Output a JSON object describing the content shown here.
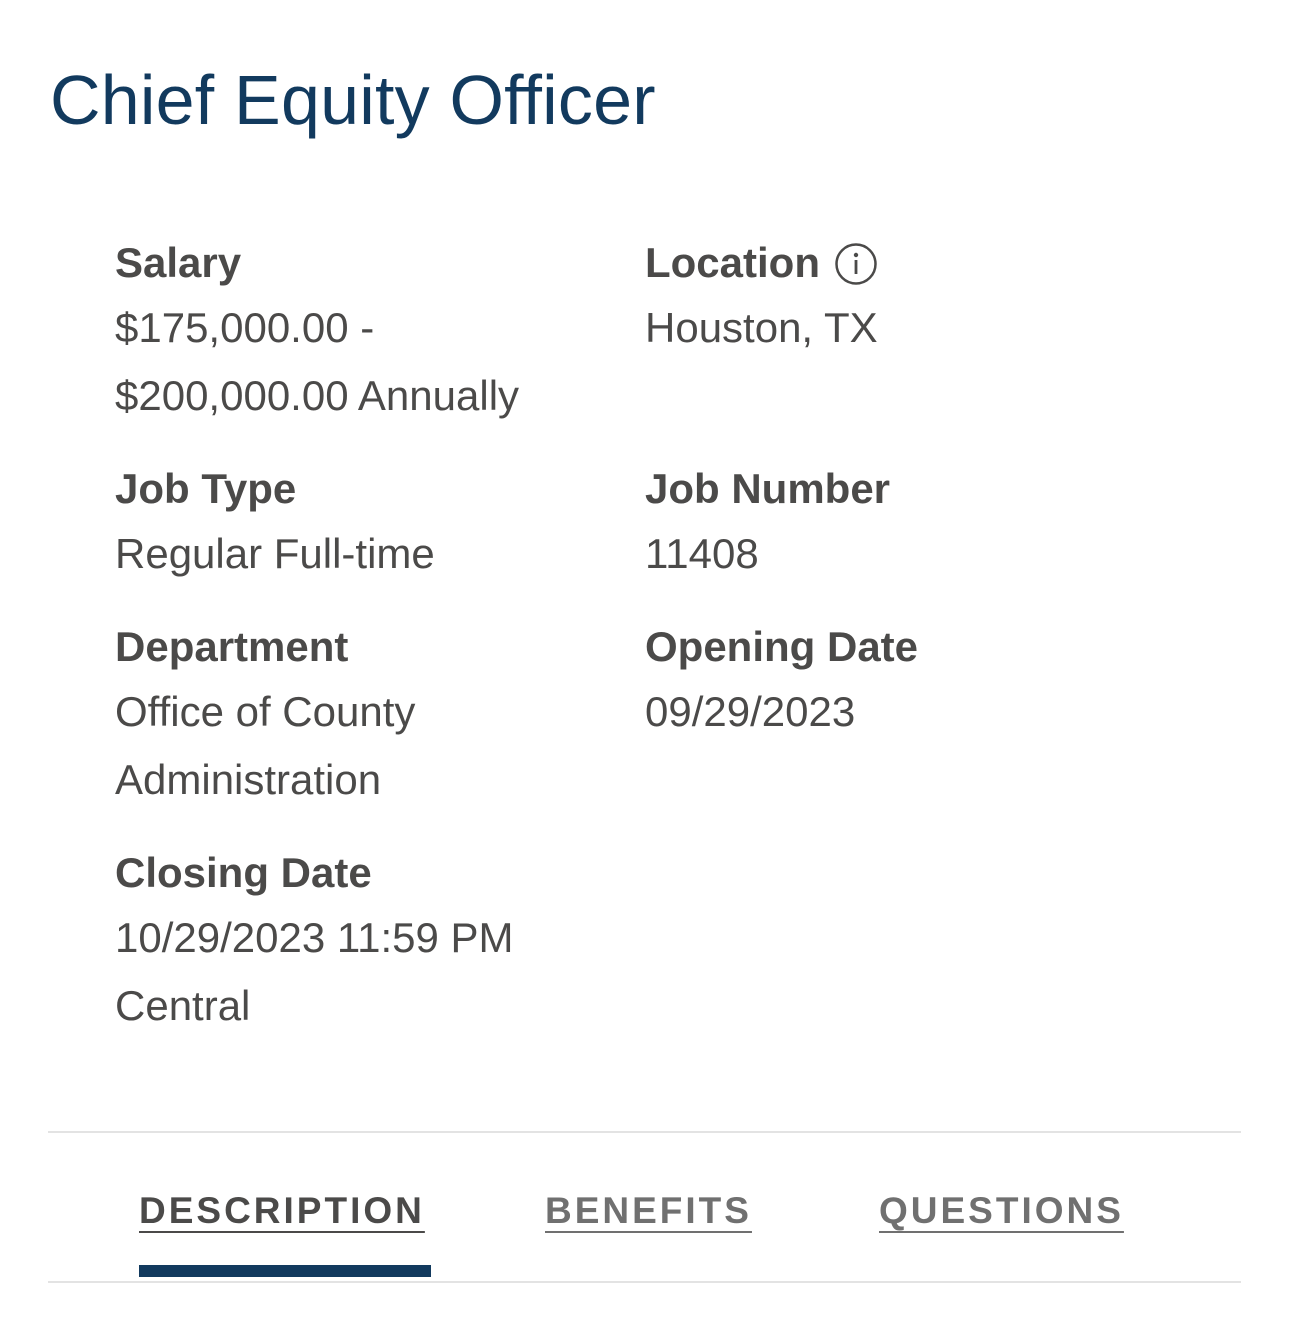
{
  "job": {
    "title": "Chief Equity Officer"
  },
  "details": {
    "salary": {
      "label": "Salary",
      "value_line1": "$175,000.00 -",
      "value_line2": "$200,000.00 Annually"
    },
    "location": {
      "label": "Location",
      "value": "Houston, TX",
      "icon": "info-icon"
    },
    "job_type": {
      "label": "Job Type",
      "value": "Regular Full-time"
    },
    "job_number": {
      "label": "Job Number",
      "value": "11408"
    },
    "department": {
      "label": "Department",
      "value_line1": "Office of County",
      "value_line2": "Administration"
    },
    "opening_date": {
      "label": "Opening Date",
      "value": "09/29/2023"
    },
    "closing_date": {
      "label": "Closing Date",
      "value_line1": "10/29/2023 11:59 PM",
      "value_line2": "Central"
    }
  },
  "tabs": [
    {
      "label": "DESCRIPTION",
      "active": true
    },
    {
      "label": "BENEFITS",
      "active": false
    },
    {
      "label": "QUESTIONS",
      "active": false
    }
  ],
  "colors": {
    "title": "#123a5e",
    "text": "#4b4a49",
    "tab_indicator": "#123a5e",
    "divider": "#e3e3e3"
  }
}
